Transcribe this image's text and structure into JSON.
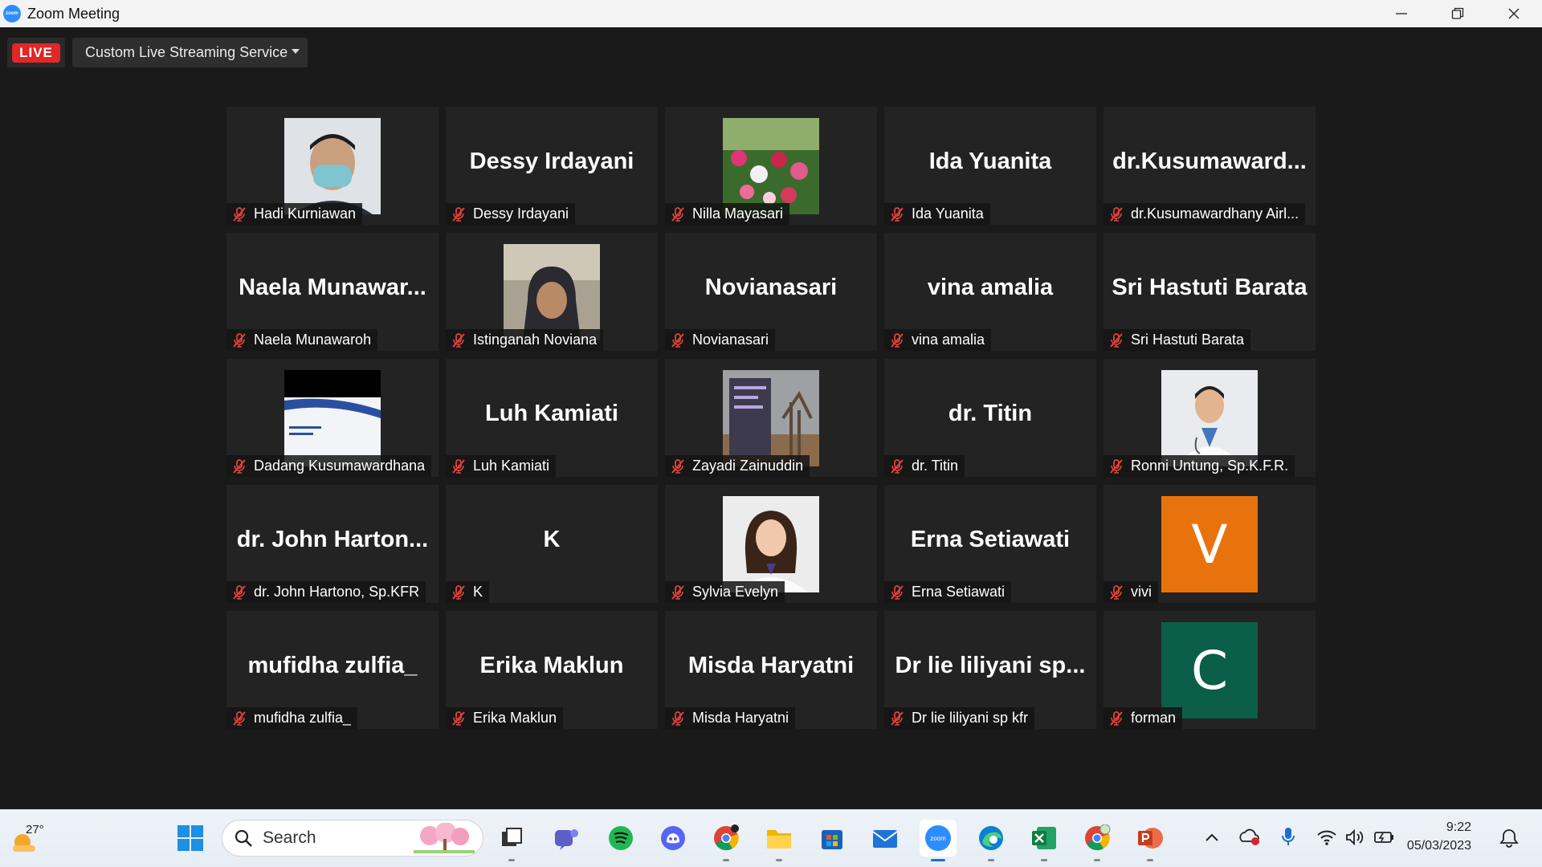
{
  "window": {
    "title": "Zoom Meeting",
    "app_icon_text": "zoom"
  },
  "toolbar": {
    "live_label": "LIVE",
    "stream_service": "Custom Live Streaming Service"
  },
  "participants": [
    {
      "label": "Hadi Kurniawan",
      "big": "",
      "type": "photo",
      "photo": "man-mask"
    },
    {
      "label": "Dessy Irdayani",
      "big": "Dessy Irdayani",
      "type": "name"
    },
    {
      "label": "Nilla Mayasari",
      "big": "",
      "type": "photo",
      "photo": "tulips"
    },
    {
      "label": "Ida Yuanita",
      "big": "Ida Yuanita",
      "type": "name"
    },
    {
      "label": "dr.Kusumawardhany Airl...",
      "big": "dr.Kusumaward...",
      "type": "name"
    },
    {
      "label": "Naela Munawaroh",
      "big": "Naela  Munawar...",
      "type": "name"
    },
    {
      "label": "Istinganah Noviana",
      "big": "",
      "type": "photo",
      "photo": "woman-hijab"
    },
    {
      "label": "Novianasari",
      "big": "Novianasari",
      "type": "name"
    },
    {
      "label": "vina amalia",
      "big": "vina amalia",
      "type": "name"
    },
    {
      "label": "Sri Hastuti Barata",
      "big": "Sri Hastuti Barata",
      "type": "name"
    },
    {
      "label": "Dadang Kusumawardhana",
      "big": "",
      "type": "photo",
      "photo": "slide"
    },
    {
      "label": "Luh Kamiati",
      "big": "Luh Kamiati",
      "type": "name"
    },
    {
      "label": "Zayadi Zainuddin",
      "big": "",
      "type": "photo",
      "photo": "sign"
    },
    {
      "label": "dr. Titin",
      "big": "dr. Titin",
      "type": "name"
    },
    {
      "label": "Ronni Untung, Sp.K.F.R.",
      "big": "",
      "type": "photo",
      "photo": "doctor"
    },
    {
      "label": "dr. John Hartono, Sp.KFR",
      "big": "dr. John Harton...",
      "type": "name"
    },
    {
      "label": "K",
      "big": "K",
      "type": "name"
    },
    {
      "label": "Sylvia Evelyn",
      "big": "",
      "type": "photo",
      "photo": "woman-coat"
    },
    {
      "label": "Erna Setiawati",
      "big": "Erna Setiawati",
      "type": "name"
    },
    {
      "label": "vivi",
      "big": "V",
      "type": "avatar",
      "color": "#e8730c"
    },
    {
      "label": "mufidha zulfia_",
      "big": "mufidha zulfia_",
      "type": "name"
    },
    {
      "label": "Erika Maklun",
      "big": "Erika Maklun",
      "type": "name"
    },
    {
      "label": "Misda Haryatni",
      "big": "Misda Haryatni",
      "type": "name"
    },
    {
      "label": "Dr lie liliyani sp kfr",
      "big": "Dr lie liliyani sp...",
      "type": "name"
    },
    {
      "label": "forman",
      "big": "C",
      "type": "avatar",
      "color": "#0b5e47"
    }
  ],
  "taskbar": {
    "weather_temp": "27°",
    "search_label": "Search",
    "apps": [
      "start-icon",
      "task-view-icon",
      "teams-icon",
      "spotify-icon",
      "discord-icon",
      "chrome-icon",
      "file-explorer-icon",
      "store-icon",
      "mail-icon",
      "zoom-icon",
      "edge-icon",
      "excel-icon",
      "chrome-profile-icon",
      "powerpoint-icon"
    ],
    "time": "9:22",
    "date": "05/03/2023"
  },
  "colors": {
    "live_red": "#e02828",
    "zoom_blue": "#2d8cff",
    "mute_red": "#e0433b"
  }
}
